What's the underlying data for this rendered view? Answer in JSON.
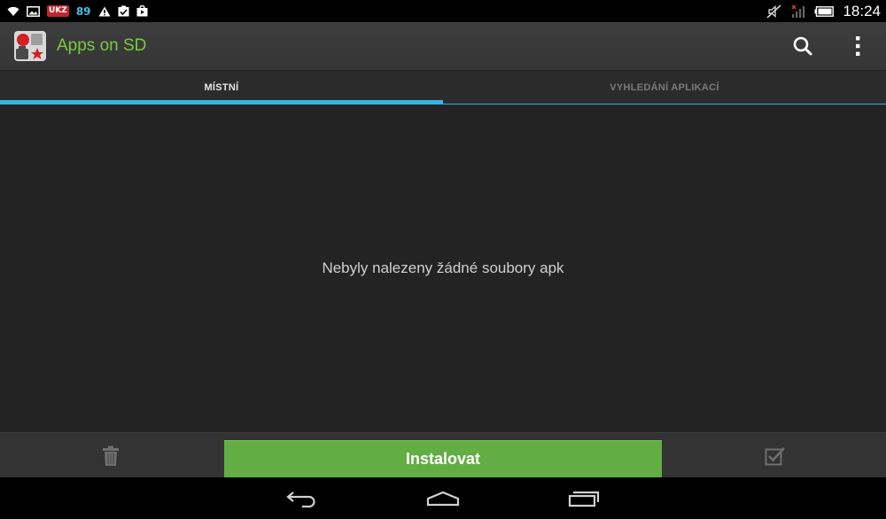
{
  "status_bar": {
    "left_icons": [
      "wifi-icon",
      "image-icon",
      "badge-icon",
      "counter",
      "warning-icon",
      "task-icon",
      "play-store-icon"
    ],
    "badge_text": "UKZ",
    "counter_text": "89",
    "right_icons": [
      "muted-icon",
      "no-signal-icon",
      "battery-icon"
    ],
    "time": "18:24"
  },
  "action_bar": {
    "title": "Apps on SD",
    "title_color": "#7ac943",
    "actions": [
      "search-icon",
      "overflow-menu-icon"
    ]
  },
  "tabs": [
    {
      "label": "MÍSTNÍ",
      "selected": true
    },
    {
      "label": "VYHLEDÁNÍ APLIKACÍ",
      "selected": false
    }
  ],
  "accent_color": "#33b5e5",
  "content": {
    "empty_message": "Nebyly nalezeny žádné soubory apk"
  },
  "bottom_bar": {
    "install_label": "Instalovat",
    "install_color": "#63ad45",
    "left_icon": "trash-icon",
    "right_icon": "checkbox-icon"
  },
  "nav_bar": {
    "buttons": [
      "back-icon",
      "home-icon",
      "recents-icon"
    ]
  }
}
